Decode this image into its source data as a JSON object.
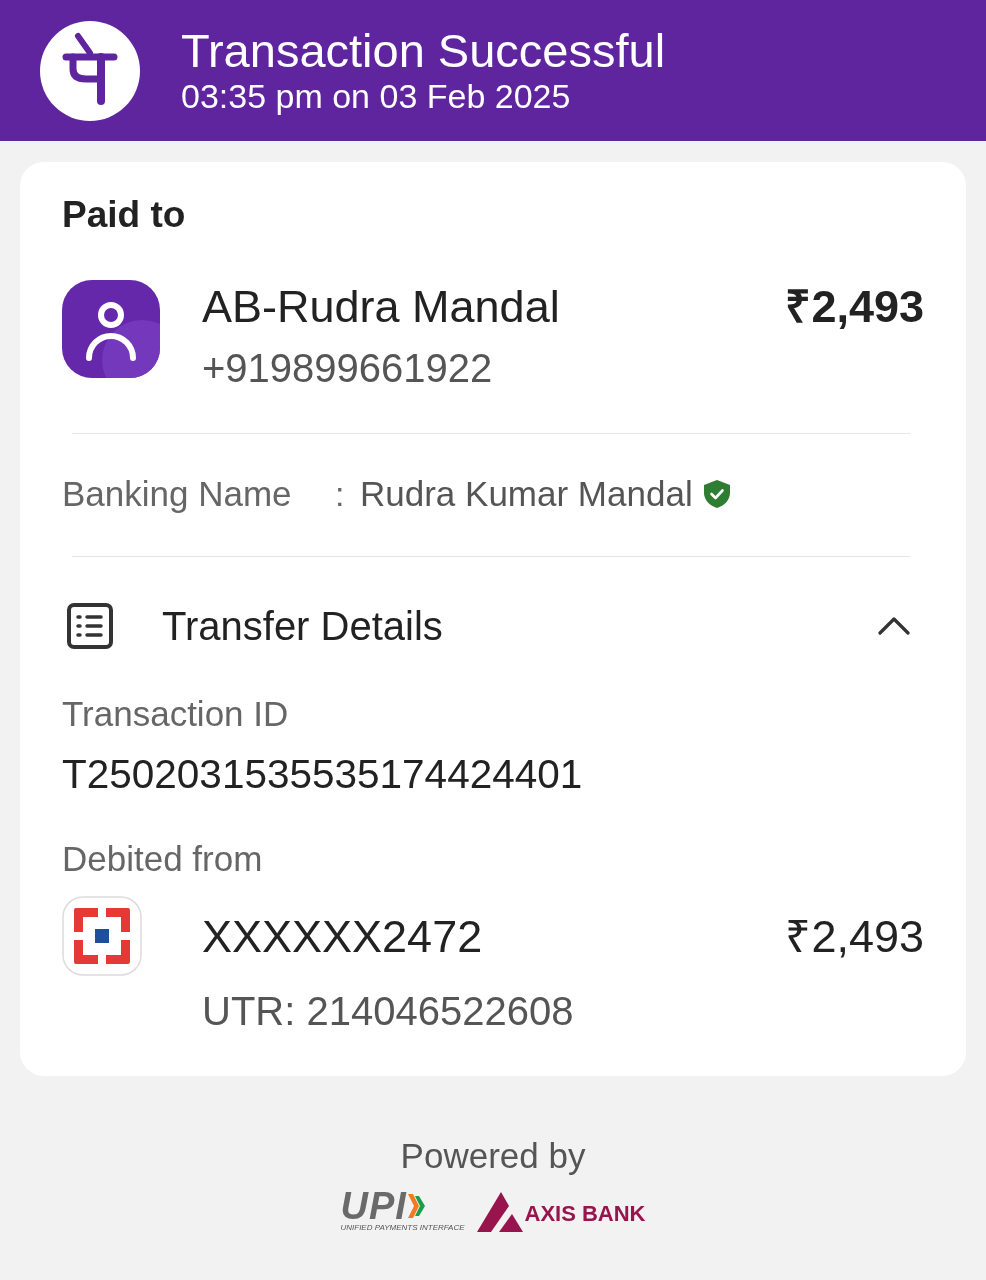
{
  "header": {
    "title": "Transaction Successful",
    "subtitle": "03:35 pm on 03 Feb 2025"
  },
  "paid_to": {
    "heading": "Paid to",
    "name": "AB-Rudra Mandal",
    "phone": "+919899661922",
    "amount": "₹2,493"
  },
  "banking_name": {
    "label": "Banking Name",
    "separator": ":",
    "value": "Rudra Kumar Mandal",
    "verified": true
  },
  "transfer_details": {
    "title": "Transfer Details",
    "expanded": true,
    "transaction_id_label": "Transaction ID",
    "transaction_id": "T2502031535535174424401",
    "debited_from_label": "Debited from",
    "account": "XXXXXX2472",
    "amount": "₹2,493",
    "utr": "UTR: 214046522608"
  },
  "footer": {
    "powered_by": "Powered by",
    "logos": [
      {
        "kind": "upi",
        "text": "UPI",
        "tagline": "UNIFIED PAYMENTS INTERFACE"
      },
      {
        "kind": "bank",
        "text": "AXIS BANK"
      }
    ]
  }
}
